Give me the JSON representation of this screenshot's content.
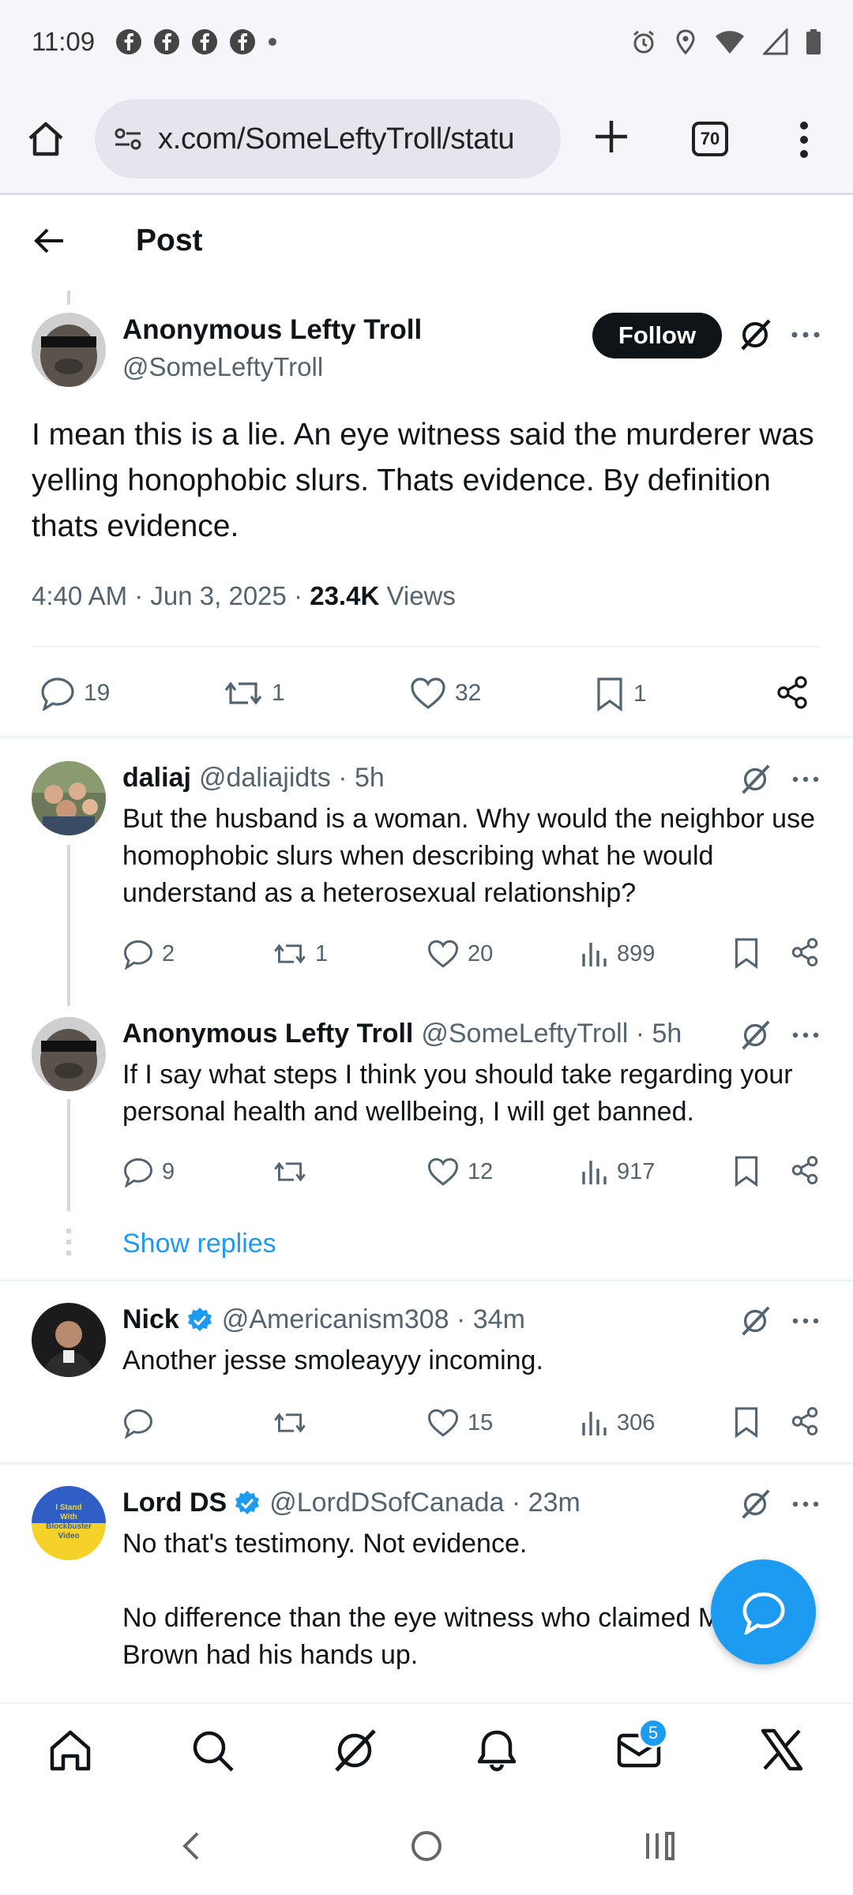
{
  "status_bar": {
    "time": "11:09"
  },
  "browser": {
    "url": "x.com/SomeLeftyTroll/statu",
    "tab_count": "70"
  },
  "header": {
    "title": "Post"
  },
  "main_post": {
    "author_name": "Anonymous Lefty Troll",
    "author_handle": "@SomeLeftyTroll",
    "follow_label": "Follow",
    "text": "I mean this is a lie. An eye witness said the murderer was yelling honophobic slurs. Thats evidence. By definition thats evidence.",
    "timestamp": "4:40 AM · Jun 3, 2025 · ",
    "views_count": "23.4K",
    "views_label": " Views",
    "replies": "19",
    "reposts": "1",
    "likes": "32",
    "bookmarks": "1"
  },
  "replies": [
    {
      "name": "daliaj",
      "handle": "@daliajidts · 5h",
      "text": "But the husband is a woman. Why would the neighbor use homophobic slurs when describing what he would understand as a heterosexual relationship?",
      "replies": "2",
      "reposts": "1",
      "likes": "20",
      "views": "899"
    },
    {
      "name": "Anonymous Lefty Troll",
      "handle": "@SomeLeftyTroll · 5h",
      "text": "If I say what steps I think you should take regarding your personal health and wellbeing, I will get banned.",
      "replies": "9",
      "reposts": "",
      "likes": "12",
      "views": "917"
    },
    {
      "name": "Nick",
      "handle": "@Americanism308 · 34m",
      "text": "Another jesse smoleayyy incoming.",
      "replies": "",
      "reposts": "",
      "likes": "15",
      "views": "306"
    },
    {
      "name": "Lord DS",
      "handle": "@LordDSofCanada · 23m",
      "text_line1": "No that's testimony. Not evidence.",
      "text_line2": "No difference than the eye witness who claimed Michael Brown had his hands up."
    }
  ],
  "show_replies_label": "Show replies",
  "avatar_text": "I Stand With Blockbuster Video",
  "nav": {
    "messages_badge": "5"
  },
  "colors": {
    "accent": "#1d9bf0",
    "text": "#0f1419",
    "muted": "#536471"
  }
}
